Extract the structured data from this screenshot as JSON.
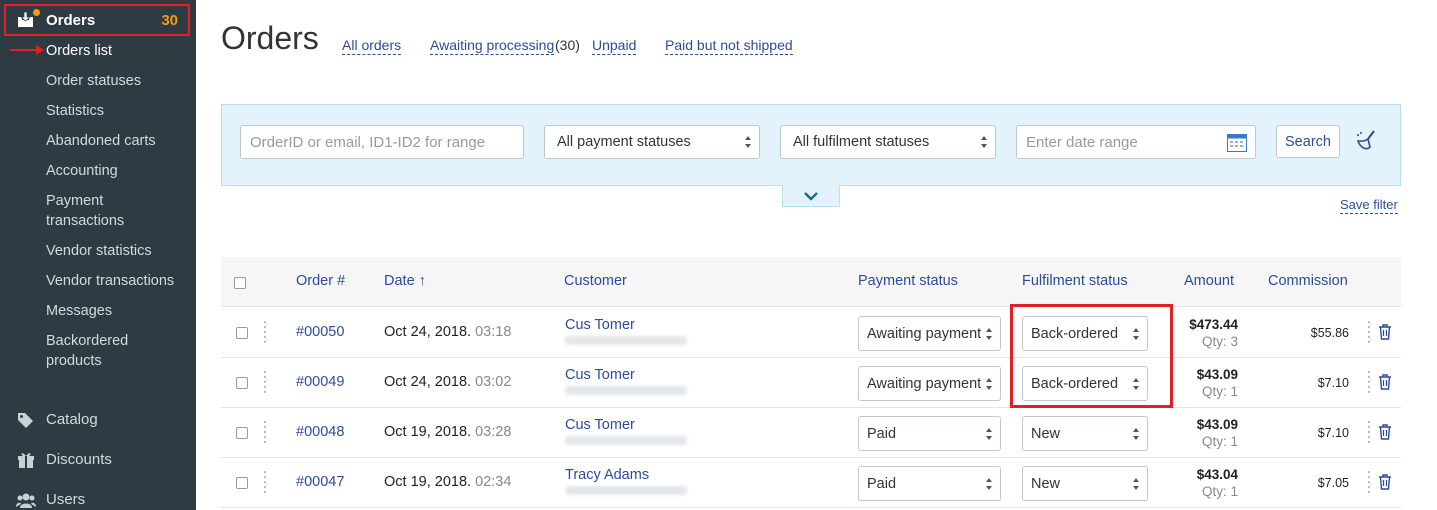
{
  "sidebar": {
    "orders": {
      "label": "Orders",
      "count": "30"
    },
    "sub_items": [
      "Orders list",
      "Order statuses",
      "Statistics",
      "Abandoned carts",
      "Accounting",
      "Payment",
      "transactions",
      "Vendor statistics",
      "Vendor transactions",
      "Messages",
      "Backordered",
      "products"
    ],
    "main_items": [
      "Catalog",
      "Discounts",
      "Users"
    ]
  },
  "header": {
    "title": "Orders",
    "links": [
      "All orders",
      "Awaiting processing",
      "Unpaid",
      "Paid but not shipped"
    ],
    "awaiting_count": "(30)"
  },
  "filter": {
    "search_placeholder": "OrderID or email, ID1-ID2 for range",
    "payment_status": "All payment statuses",
    "fulfilment_status": "All fulfilment statuses",
    "date_placeholder": "Enter date range",
    "search_label": "Search",
    "save_filter": "Save filter"
  },
  "table": {
    "columns": [
      "Order #",
      "Date",
      "Customer",
      "Payment status",
      "Fulfilment status",
      "Amount",
      "Commission"
    ],
    "sort_arrow": "↑",
    "rows": [
      {
        "id": "#00050",
        "date": "Oct 24, 2018.",
        "time": "03:18",
        "customer": "Cus Tomer",
        "payment": "Awaiting payment",
        "fulfilment": "Back-ordered",
        "amount": "$473.44",
        "qty": "Qty: 3",
        "commission": "$55.86"
      },
      {
        "id": "#00049",
        "date": "Oct 24, 2018.",
        "time": "03:02",
        "customer": "Cus Tomer",
        "payment": "Awaiting payment",
        "fulfilment": "Back-ordered",
        "amount": "$43.09",
        "qty": "Qty: 1",
        "commission": "$7.10"
      },
      {
        "id": "#00048",
        "date": "Oct 19, 2018.",
        "time": "03:28",
        "customer": "Cus Tomer",
        "payment": "Paid",
        "fulfilment": "New",
        "amount": "$43.09",
        "qty": "Qty: 1",
        "commission": "$7.10"
      },
      {
        "id": "#00047",
        "date": "Oct 19, 2018.",
        "time": "02:34",
        "customer": "Tracy Adams",
        "payment": "Paid",
        "fulfilment": "New",
        "amount": "$43.04",
        "qty": "Qty: 1",
        "commission": "$7.05"
      }
    ]
  },
  "colors": {
    "sidebar_bg": "#2e3b43",
    "accent": "#f39c12",
    "link": "#2d4b9a",
    "highlight": "#e31e24",
    "filter_bg": "#e2f3fc"
  }
}
